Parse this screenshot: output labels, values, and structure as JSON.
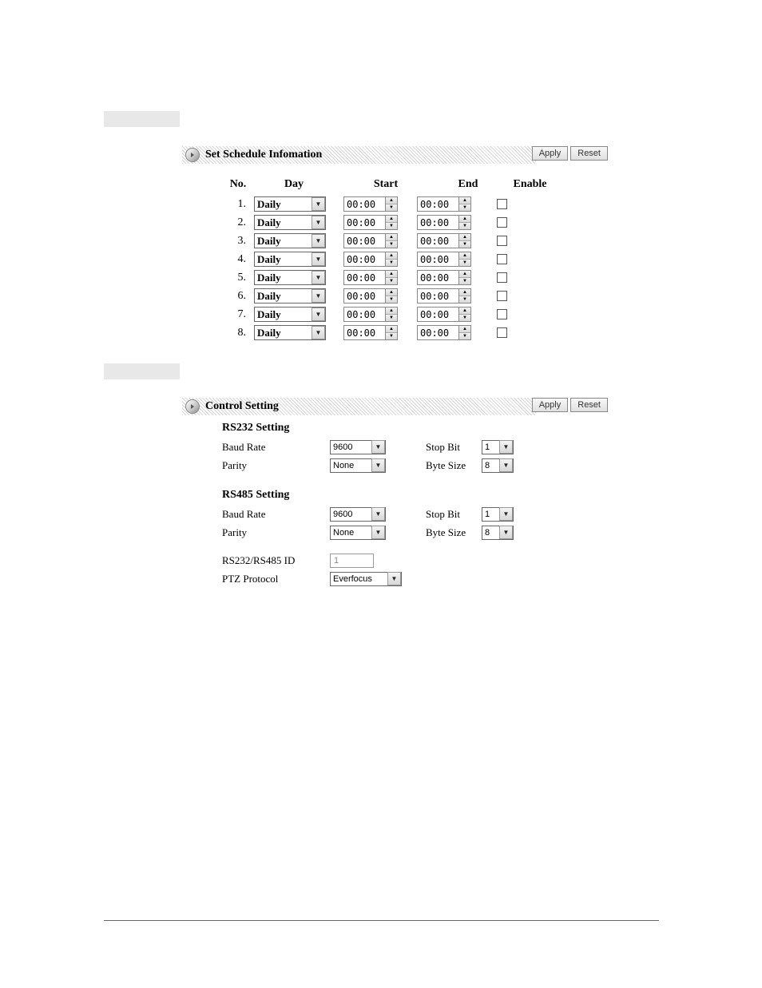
{
  "schedule_panel": {
    "title": "Set Schedule Infomation",
    "apply_label": "Apply",
    "reset_label": "Reset",
    "headers": {
      "no": "No.",
      "day": "Day",
      "start": "Start",
      "end": "End",
      "enable": "Enable"
    },
    "rows": [
      {
        "no": "1.",
        "day": "Daily",
        "start": "00:00",
        "end": "00:00"
      },
      {
        "no": "2.",
        "day": "Daily",
        "start": "00:00",
        "end": "00:00"
      },
      {
        "no": "3.",
        "day": "Daily",
        "start": "00:00",
        "end": "00:00"
      },
      {
        "no": "4.",
        "day": "Daily",
        "start": "00:00",
        "end": "00:00"
      },
      {
        "no": "5.",
        "day": "Daily",
        "start": "00:00",
        "end": "00:00"
      },
      {
        "no": "6.",
        "day": "Daily",
        "start": "00:00",
        "end": "00:00"
      },
      {
        "no": "7.",
        "day": "Daily",
        "start": "00:00",
        "end": "00:00"
      },
      {
        "no": "8.",
        "day": "Daily",
        "start": "00:00",
        "end": "00:00"
      }
    ]
  },
  "control_panel": {
    "title": "Control Setting",
    "apply_label": "Apply",
    "reset_label": "Reset",
    "rs232": {
      "section": "RS232 Setting",
      "baud_label": "Baud Rate",
      "baud_value": "9600",
      "stopbit_label": "Stop Bit",
      "stopbit_value": "1",
      "parity_label": "Parity",
      "parity_value": "None",
      "bytesize_label": "Byte Size",
      "bytesize_value": "8"
    },
    "rs485": {
      "section": "RS485 Setting",
      "baud_label": "Baud Rate",
      "baud_value": "9600",
      "stopbit_label": "Stop Bit",
      "stopbit_value": "1",
      "parity_label": "Parity",
      "parity_value": "None",
      "bytesize_label": "Byte Size",
      "bytesize_value": "8"
    },
    "id_label": "RS232/RS485 ID",
    "id_value": "1",
    "ptz_label": "PTZ Protocol",
    "ptz_value": "Everfocus"
  }
}
